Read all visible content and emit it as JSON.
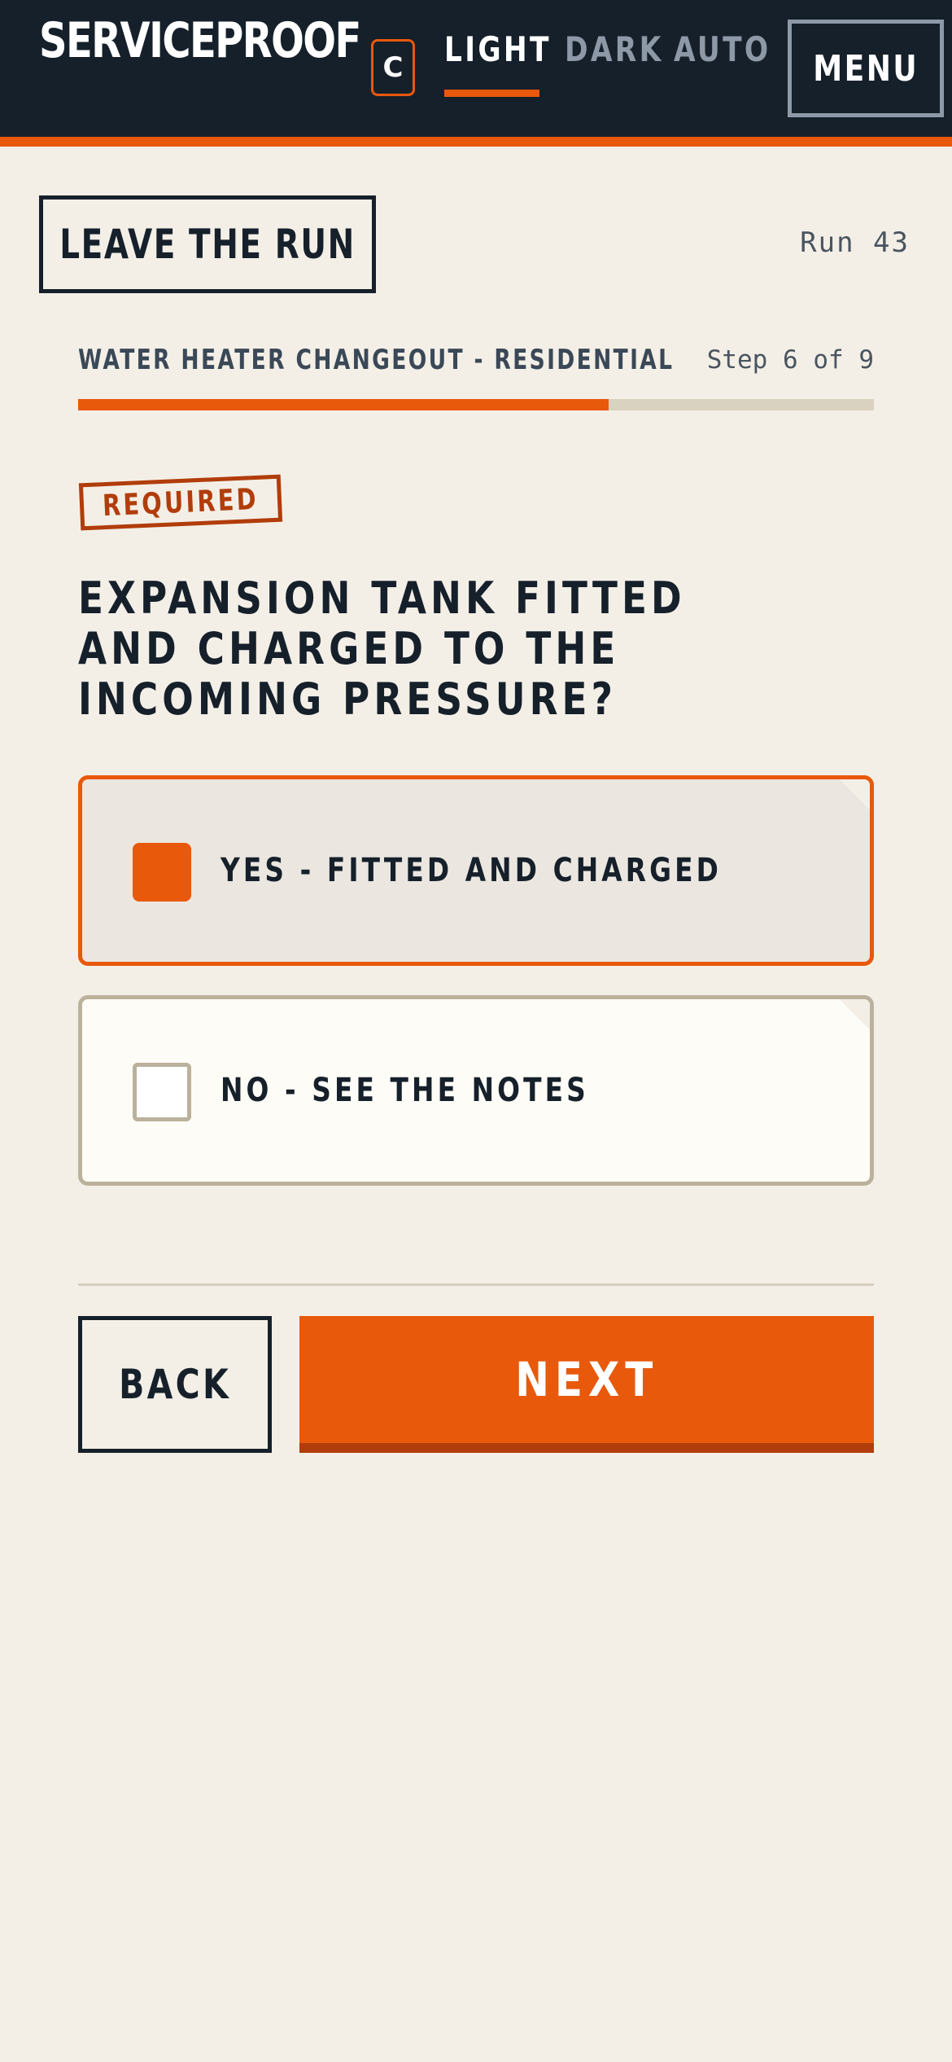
{
  "header": {
    "brand": "SERVICEPROOF",
    "badge": "C",
    "theme_tabs": [
      "LIGHT",
      "DARK",
      "AUTO"
    ],
    "active_theme": "LIGHT",
    "menu_label": "MENU"
  },
  "run": {
    "leave_label": "LEAVE THE RUN",
    "run_label": "Run 43"
  },
  "progress": {
    "job_title": "WATER HEATER CHANGEOUT - RESIDENTIAL",
    "step_label": "Step 6 of 9",
    "fraction": 0.667
  },
  "question": {
    "badge": "REQUIRED",
    "lines": [
      "EXPANSION TANK FITTED",
      "AND CHARGED TO THE",
      "INCOMING PRESSURE?"
    ]
  },
  "options": [
    {
      "label": "YES - FITTED AND CHARGED",
      "selected": true
    },
    {
      "label": "NO - SEE THE NOTES",
      "selected": false
    }
  ],
  "nav": {
    "back_label": "BACK",
    "next_label": "NEXT"
  },
  "colors": {
    "accent": "#e8590c",
    "header_bg": "#16202b",
    "page_bg": "#f3efe7"
  }
}
